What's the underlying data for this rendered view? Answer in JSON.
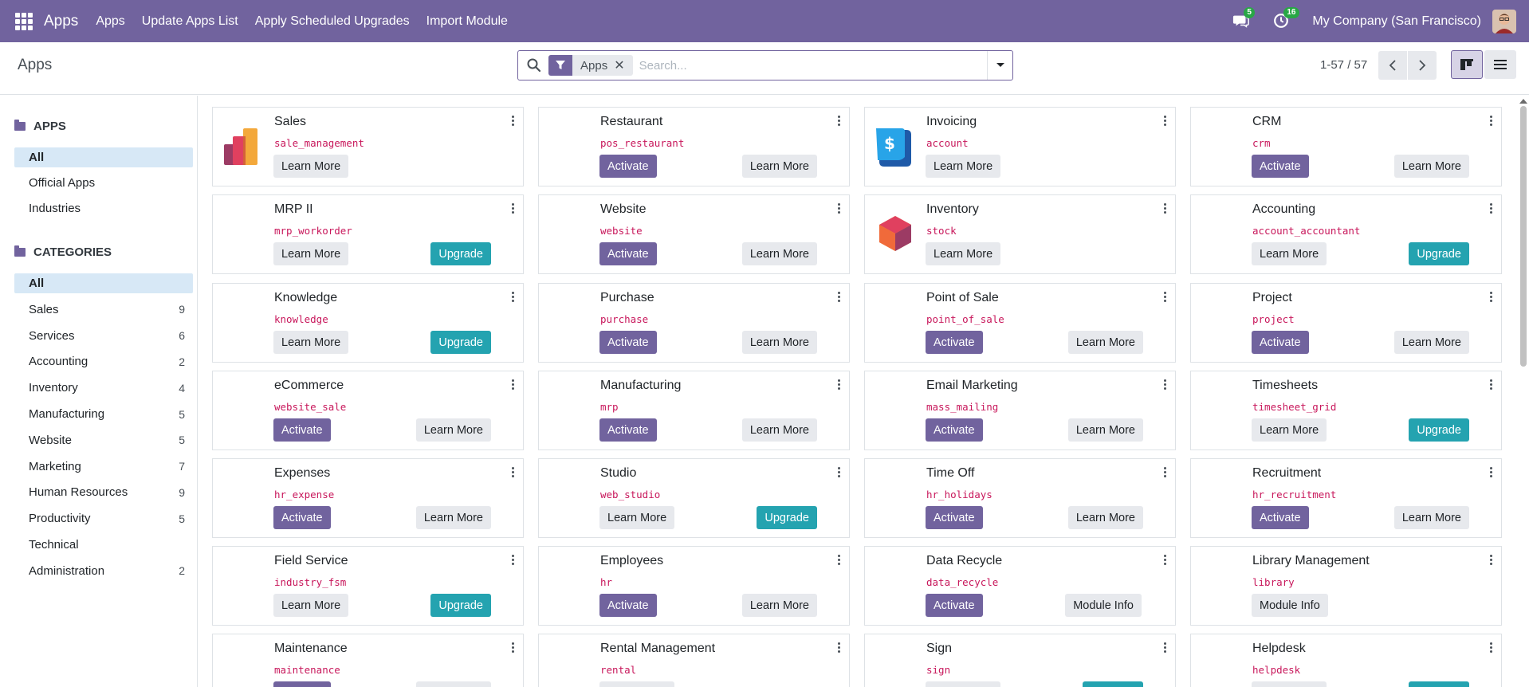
{
  "navbar": {
    "brand": "Apps",
    "menu": [
      "Apps",
      "Update Apps List",
      "Apply Scheduled Upgrades",
      "Import Module"
    ],
    "messages_count": "5",
    "activities_count": "16",
    "company": "My Company (San Francisco)",
    "bg_color": "#71639e"
  },
  "control": {
    "breadcrumb": "Apps",
    "facet_label": "Apps",
    "search_placeholder": "Search...",
    "pager": "1-57 / 57"
  },
  "sidebar": {
    "apps_header": "APPS",
    "apps_items": [
      "All",
      "Official Apps",
      "Industries"
    ],
    "categories_header": "CATEGORIES",
    "categories": [
      {
        "label": "All",
        "count": ""
      },
      {
        "label": "Sales",
        "count": "9"
      },
      {
        "label": "Services",
        "count": "6"
      },
      {
        "label": "Accounting",
        "count": "2"
      },
      {
        "label": "Inventory",
        "count": "4"
      },
      {
        "label": "Manufacturing",
        "count": "5"
      },
      {
        "label": "Website",
        "count": "5"
      },
      {
        "label": "Marketing",
        "count": "7"
      },
      {
        "label": "Human Resources",
        "count": "9"
      },
      {
        "label": "Productivity",
        "count": "5"
      },
      {
        "label": "Technical",
        "count": ""
      },
      {
        "label": "Administration",
        "count": "2"
      }
    ]
  },
  "labels": {
    "learn_more": "Learn More",
    "activate": "Activate",
    "upgrade": "Upgrade",
    "module_info": "Module Info"
  },
  "apps": [
    {
      "name": "Sales",
      "tech": "sale_management",
      "left": "learn_more",
      "right": "",
      "icon": "sales-icon"
    },
    {
      "name": "Restaurant",
      "tech": "pos_restaurant",
      "left": "activate",
      "right": "learn_more",
      "icon": ""
    },
    {
      "name": "Invoicing",
      "tech": "account",
      "left": "learn_more",
      "right": "",
      "icon": "invoicing-icon"
    },
    {
      "name": "CRM",
      "tech": "crm",
      "left": "activate",
      "right": "learn_more",
      "icon": ""
    },
    {
      "name": "MRP II",
      "tech": "mrp_workorder",
      "left": "learn_more",
      "right": "upgrade",
      "icon": ""
    },
    {
      "name": "Website",
      "tech": "website",
      "left": "activate",
      "right": "learn_more",
      "icon": ""
    },
    {
      "name": "Inventory",
      "tech": "stock",
      "left": "learn_more",
      "right": "",
      "icon": "inventory-icon"
    },
    {
      "name": "Accounting",
      "tech": "account_accountant",
      "left": "learn_more",
      "right": "upgrade",
      "icon": ""
    },
    {
      "name": "Knowledge",
      "tech": "knowledge",
      "left": "learn_more",
      "right": "upgrade",
      "icon": ""
    },
    {
      "name": "Purchase",
      "tech": "purchase",
      "left": "activate",
      "right": "learn_more",
      "icon": ""
    },
    {
      "name": "Point of Sale",
      "tech": "point_of_sale",
      "left": "activate",
      "right": "learn_more",
      "icon": ""
    },
    {
      "name": "Project",
      "tech": "project",
      "left": "activate",
      "right": "learn_more",
      "icon": ""
    },
    {
      "name": "eCommerce",
      "tech": "website_sale",
      "left": "activate",
      "right": "learn_more",
      "icon": ""
    },
    {
      "name": "Manufacturing",
      "tech": "mrp",
      "left": "activate",
      "right": "learn_more",
      "icon": ""
    },
    {
      "name": "Email Marketing",
      "tech": "mass_mailing",
      "left": "activate",
      "right": "learn_more",
      "icon": ""
    },
    {
      "name": "Timesheets",
      "tech": "timesheet_grid",
      "left": "learn_more",
      "right": "upgrade",
      "icon": ""
    },
    {
      "name": "Expenses",
      "tech": "hr_expense",
      "left": "activate",
      "right": "learn_more",
      "icon": ""
    },
    {
      "name": "Studio",
      "tech": "web_studio",
      "left": "learn_more",
      "right": "upgrade",
      "icon": ""
    },
    {
      "name": "Time Off",
      "tech": "hr_holidays",
      "left": "activate",
      "right": "learn_more",
      "icon": ""
    },
    {
      "name": "Recruitment",
      "tech": "hr_recruitment",
      "left": "activate",
      "right": "learn_more",
      "icon": ""
    },
    {
      "name": "Field Service",
      "tech": "industry_fsm",
      "left": "learn_more",
      "right": "upgrade",
      "icon": ""
    },
    {
      "name": "Employees",
      "tech": "hr",
      "left": "activate",
      "right": "learn_more",
      "icon": ""
    },
    {
      "name": "Data Recycle",
      "tech": "data_recycle",
      "left": "activate",
      "right": "module_info",
      "icon": ""
    },
    {
      "name": "Library Management",
      "tech": "library",
      "left": "module_info",
      "right": "",
      "icon": ""
    },
    {
      "name": "Maintenance",
      "tech": "maintenance",
      "left": "activate",
      "right": "learn_more",
      "icon": ""
    },
    {
      "name": "Rental Management",
      "tech": "rental",
      "left": "learn_more",
      "right": "",
      "icon": ""
    },
    {
      "name": "Sign",
      "tech": "sign",
      "left": "learn_more",
      "right": "upgrade",
      "icon": ""
    },
    {
      "name": "Helpdesk",
      "tech": "helpdesk",
      "left": "learn_more",
      "right": "upgrade",
      "icon": ""
    }
  ]
}
